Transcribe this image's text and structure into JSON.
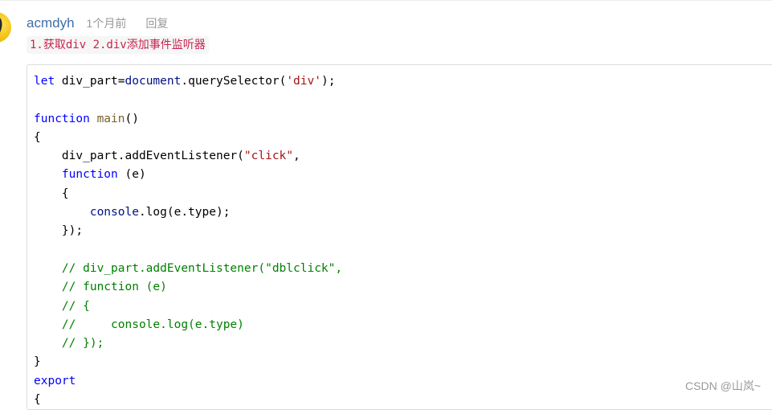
{
  "comment": {
    "username": "acmdyh",
    "time": "1个月前",
    "reply_label": "回复",
    "text": "1.获取div 2.div添加事件监听器"
  },
  "code": {
    "lines": [
      [
        {
          "t": "let",
          "c": "kw"
        },
        {
          "t": " div_part="
        },
        {
          "t": "document",
          "c": "obj"
        },
        {
          "t": ".querySelector("
        },
        {
          "t": "'div'",
          "c": "str"
        },
        {
          "t": ");"
        }
      ],
      [],
      [
        {
          "t": "function",
          "c": "kw"
        },
        {
          "t": " "
        },
        {
          "t": "main",
          "c": "fn"
        },
        {
          "t": "()"
        }
      ],
      [
        {
          "t": "{"
        }
      ],
      [
        {
          "t": "    div_part.addEventListener("
        },
        {
          "t": "\"click\"",
          "c": "str"
        },
        {
          "t": ","
        }
      ],
      [
        {
          "t": "    "
        },
        {
          "t": "function",
          "c": "kw"
        },
        {
          "t": " (e)"
        }
      ],
      [
        {
          "t": "    {"
        }
      ],
      [
        {
          "t": "        "
        },
        {
          "t": "console",
          "c": "obj"
        },
        {
          "t": ".log(e.type);"
        }
      ],
      [
        {
          "t": "    });"
        }
      ],
      [],
      [
        {
          "t": "    "
        },
        {
          "t": "// div_part.addEventListener(\"dblclick\",",
          "c": "cm"
        }
      ],
      [
        {
          "t": "    "
        },
        {
          "t": "// function (e)",
          "c": "cm"
        }
      ],
      [
        {
          "t": "    "
        },
        {
          "t": "// {",
          "c": "cm"
        }
      ],
      [
        {
          "t": "    "
        },
        {
          "t": "//     console.log(e.type)",
          "c": "cm"
        }
      ],
      [
        {
          "t": "    "
        },
        {
          "t": "// });",
          "c": "cm"
        }
      ],
      [
        {
          "t": "}"
        }
      ],
      [
        {
          "t": "export",
          "c": "kw"
        }
      ],
      [
        {
          "t": "{"
        }
      ]
    ]
  },
  "watermark": "CSDN @山岚~",
  "colors": {
    "username": "#3f6fa8",
    "meta": "#999999",
    "inline_code": "#c7254e",
    "keyword": "#0000ff",
    "string": "#a31515",
    "comment": "#008000"
  },
  "icons": {
    "avatar": "avatar-image"
  }
}
